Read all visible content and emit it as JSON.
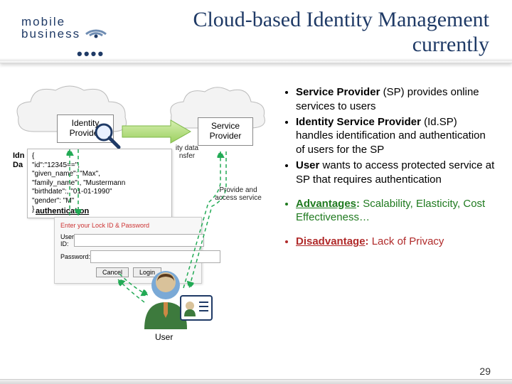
{
  "logo": {
    "line1": "mobile",
    "line2": "business"
  },
  "title": "Cloud-based Identity Management currently",
  "bullets": {
    "sp": {
      "term": "Service Provider",
      "abbrev": "(SP)",
      "rest": "provides online services to users"
    },
    "idsp": {
      "term": "Identity Service Provider",
      "abbrev": "(Id.SP)",
      "rest": "handles identification and authentication of users for the SP"
    },
    "user": {
      "term": "User",
      "rest": "wants to access protected service at SP that requires authentication"
    }
  },
  "advantages": {
    "label": "Advantages",
    "text": "Scalability, Elasticity, Cost Effectiveness…"
  },
  "disadvantage": {
    "label": "Disadvantage",
    "text": "Lack of Privacy"
  },
  "diagram": {
    "idp_label": "Identity\nProvider",
    "sp_label": "Service\nProvider",
    "arrow_label_top": "ity data\nnsfer",
    "arrow_label_right": "Provide and\naccess service",
    "auth_fragment": "authentication",
    "idn_fragment": "Idn\nDa",
    "json_snippet": "{\n\"id\":\"12345==\",\n\"given_name\": \"Max\",\n\"family_name\":, \"Mustermann\n\"birthdate\":, \"01-01-1990\"\n\"gender\": \"M\"\n}",
    "login": {
      "header": "Enter your Lock ID & Password",
      "user_lbl": "User ID:",
      "pwd_lbl": "Password:",
      "cancel": "Cancel",
      "login": "Login"
    },
    "user_label": "User"
  },
  "page_number": "29"
}
